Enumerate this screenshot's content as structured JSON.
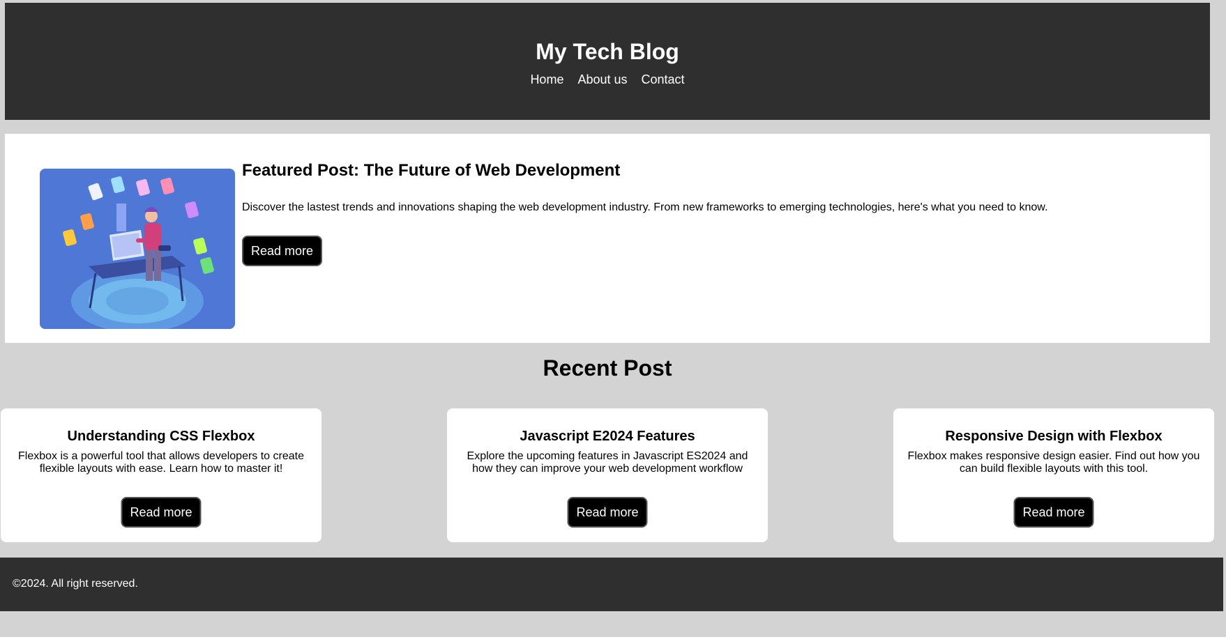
{
  "header": {
    "title": "My Tech Blog",
    "nav": [
      {
        "label": "Home"
      },
      {
        "label": "About us"
      },
      {
        "label": "Contact"
      }
    ]
  },
  "featured": {
    "title": "Featured Post: The Future of Web Development",
    "description": "Discover the lastest trends and innovations shaping the web development industry. From new frameworks to emerging technologies, here's what you need to know.",
    "button_label": "Read more",
    "image_icon": "web-developer-illustration"
  },
  "recent": {
    "heading": "Recent Post",
    "posts": [
      {
        "title": "Understanding CSS Flexbox",
        "description": "Flexbox is a powerful tool that allows developers to create flexible layouts with ease. Learn how to master it!",
        "button_label": "Read more"
      },
      {
        "title": "Javascript E2024 Features",
        "description": "Explore the upcoming features in Javascript ES2024 and how they can improve your web development workflow",
        "button_label": "Read more"
      },
      {
        "title": "Responsive Design with Flexbox",
        "description": "Flexbox makes responsive design easier. Find out how you can build flexible layouts with this tool.",
        "button_label": "Read more"
      }
    ]
  },
  "footer": {
    "text": "©2024. All right reserved."
  },
  "colors": {
    "page_bg": "#d3d3d3",
    "header_bg": "#2f2f2f",
    "button_bg": "#000000",
    "image_bg": "#4f78d6"
  }
}
